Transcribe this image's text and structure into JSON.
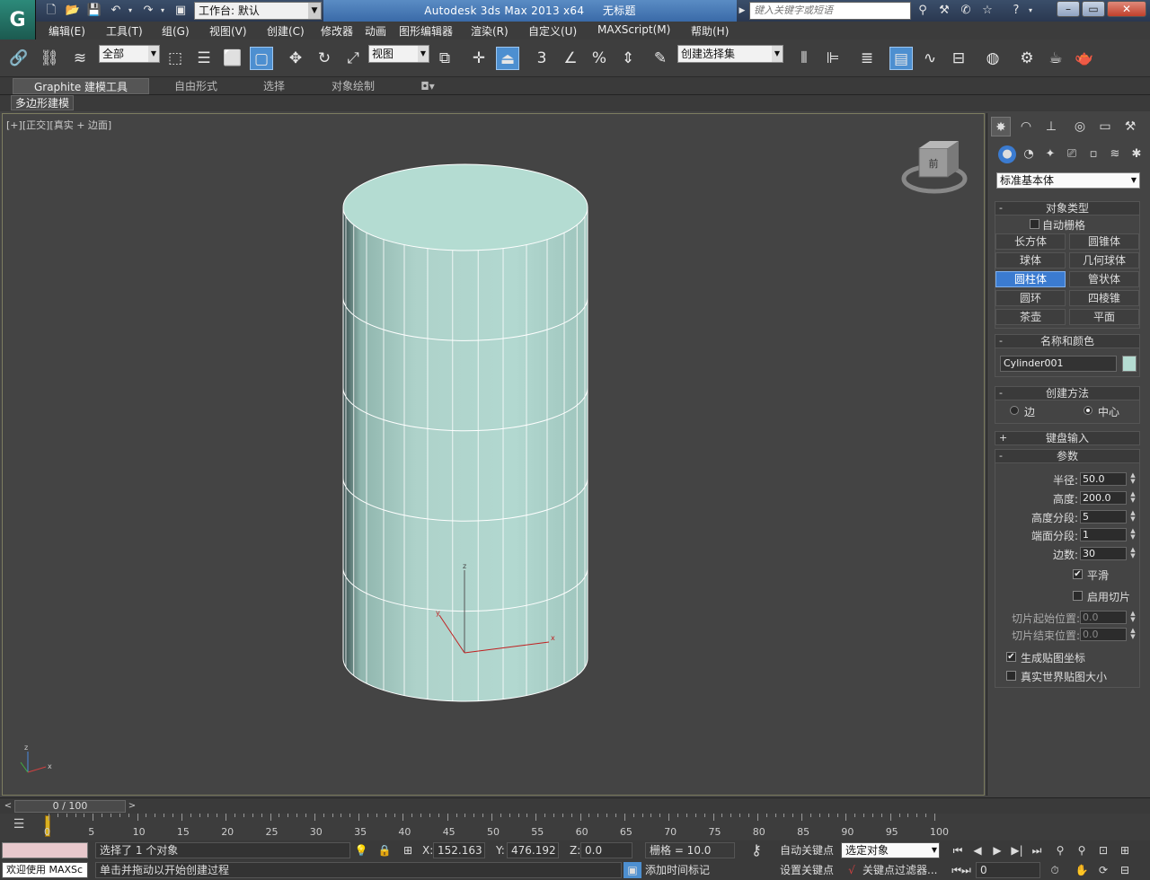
{
  "titlebar": {
    "logo": "G",
    "workspace_label": "工作台: 默认",
    "app_title": "Autodesk 3ds Max  2013 x64",
    "document_title": "无标题",
    "search_placeholder": "键入关键字或短语"
  },
  "menus": [
    "编辑(E)",
    "工具(T)",
    "组(G)",
    "视图(V)",
    "创建(C)",
    "修改器",
    "动画",
    "图形编辑器",
    "渲染(R)",
    "自定义(U)",
    "MAXScript(M)",
    "帮助(H)"
  ],
  "toolbar": {
    "selection_filter": "全部",
    "ref_coord": "视图",
    "named_selection": "创建选择集",
    "snap_label": "3",
    "angle_label": "%"
  },
  "ribbon": {
    "tabs": [
      "Graphite 建模工具",
      "自由形式",
      "选择",
      "对象绘制"
    ],
    "subtab": "多边形建模"
  },
  "viewport": {
    "label_plus": "[+]",
    "label_view": "[正交]",
    "label_shading": "[真实 + 边面]",
    "viewcube_face": "前",
    "axis_x": "x",
    "axis_y": "y",
    "axis_z": "z",
    "cylinder_color": "#b4dcd2"
  },
  "command_panel": {
    "category": "标准基本体",
    "object_type_title": "对象类型",
    "autogrid_label": "自动栅格",
    "objects": [
      "长方体",
      "圆锥体",
      "球体",
      "几何球体",
      "圆柱体",
      "管状体",
      "圆环",
      "四棱锥",
      "茶壶",
      "平面"
    ],
    "active_object": "圆柱体",
    "name_color_title": "名称和颜色",
    "object_name": "Cylinder001",
    "creation_method_title": "创建方法",
    "method_edge": "边",
    "method_center": "中心",
    "keyboard_entry_title": "键盘输入",
    "params_title": "参数",
    "params": {
      "radius_label": "半径:",
      "radius": "50.0",
      "height_label": "高度:",
      "height": "200.0",
      "height_segs_label": "高度分段:",
      "height_segs": "5",
      "cap_segs_label": "端面分段:",
      "cap_segs": "1",
      "sides_label": "边数:",
      "sides": "30",
      "smooth_label": "平滑",
      "slice_on_label": "启用切片",
      "slice_from_label": "切片起始位置:",
      "slice_from": "0.0",
      "slice_to_label": "切片结束位置:",
      "slice_to": "0.0",
      "gen_mapping_label": "生成贴图坐标",
      "real_world_label": "真实世界贴图大小"
    }
  },
  "timeline": {
    "slider": "0 / 100",
    "ticks": [
      "0",
      "5",
      "10",
      "15",
      "20",
      "25",
      "30",
      "35",
      "40",
      "45",
      "50",
      "55",
      "60",
      "65",
      "70",
      "75",
      "80",
      "85",
      "90",
      "95",
      "100"
    ]
  },
  "status": {
    "welcome": "欢迎使用 MAXSc",
    "selected": "选择了 1 个对象",
    "prompt": "单击并拖动以开始创建过程",
    "x_label": "X:",
    "x": "152.163",
    "y_label": "Y:",
    "y": "476.192",
    "z_label": "Z:",
    "z": "0.0",
    "grid": "栅格 = 10.0",
    "auto_key": "自动关键点",
    "set_key": "设置关键点",
    "key_mode": "选定对象",
    "key_filters": "关键点过滤器...",
    "add_time_tag": "添加时间标记",
    "frame": "0"
  }
}
